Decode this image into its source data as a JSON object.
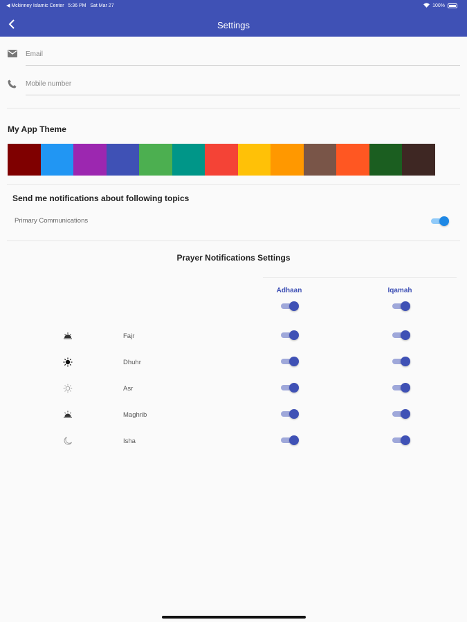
{
  "status_bar": {
    "back_app": "◀ Mckinney Islamic Center",
    "time": "5:36 PM",
    "date": "Sat Mar 27",
    "battery": "100%"
  },
  "header": {
    "title": "Settings"
  },
  "form": {
    "email_placeholder": "Email",
    "mobile_placeholder": "Mobile number"
  },
  "theme": {
    "title": "My App Theme",
    "colors": [
      "#7f0000",
      "#2196f3",
      "#9c27b0",
      "#3f51b5",
      "#4caf50",
      "#009688",
      "#f44336",
      "#ffc107",
      "#ff9800",
      "#795548",
      "#ff5722",
      "#1b5e20",
      "#3e2723"
    ]
  },
  "notifications": {
    "title": "Send me notifications about following topics",
    "topics": [
      {
        "label": "Primary Communications",
        "enabled": true
      }
    ]
  },
  "prayer": {
    "title": "Prayer Notifications Settings",
    "col_adhaan": "Adhaan",
    "col_iqamah": "Iqamah",
    "all_adhaan": true,
    "all_iqamah": true,
    "rows": [
      {
        "name": "Fajr",
        "icon": "sunrise-icon",
        "adhaan": true,
        "iqamah": true
      },
      {
        "name": "Dhuhr",
        "icon": "sun-icon",
        "adhaan": true,
        "iqamah": true
      },
      {
        "name": "Asr",
        "icon": "sun-outline-icon",
        "adhaan": true,
        "iqamah": true
      },
      {
        "name": "Maghrib",
        "icon": "sunset-icon",
        "adhaan": true,
        "iqamah": true
      },
      {
        "name": "Isha",
        "icon": "moon-icon",
        "adhaan": true,
        "iqamah": true
      }
    ]
  }
}
